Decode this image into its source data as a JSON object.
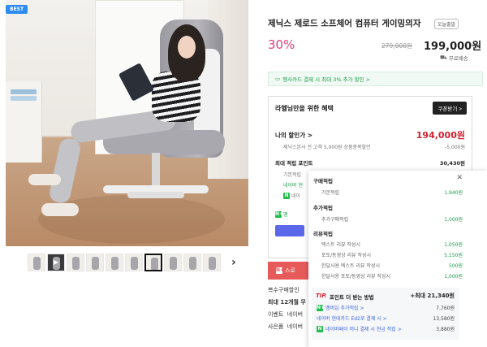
{
  "gallery": {
    "badge": "BEST",
    "thumb_count": 10,
    "selected_thumb": 7,
    "next_icon": "chevron-right-icon"
  },
  "product": {
    "title": "제닉스 제로드 소프체어 컴퓨터 게이밍의자",
    "chip": "오늘출발",
    "discount": "30%",
    "original_price": "279,000원",
    "price": "199,000원",
    "shipping": "무료배송"
  },
  "promo": {
    "text": "행사카드 결제 시 최대 3% 추가 할인 >"
  },
  "benefit": {
    "title": "라헬님만을 위한 혜택",
    "coupon_button": "쿠폰받기 >",
    "my_price_label": "나의 할인가 >",
    "my_price": "194,000원",
    "my_price_sub": "제닉스본사 전 고객 5,000원 상품중복할인",
    "my_price_sub_value": "-5,000원",
    "points_label": "최대 적립 포인트",
    "points_value": "30,430원",
    "points_rows": [
      "기본적립",
      "네이버 현",
      "네이"
    ],
    "naver_badge": "N",
    "naver_plus_label": "멤"
  },
  "popover": {
    "close_icon": "close-icon",
    "sections": [
      {
        "heading": "구매적립",
        "items": [
          {
            "label": "기본적립",
            "value": "1,940원"
          }
        ]
      },
      {
        "heading": "추가적립",
        "items": [
          {
            "label": "추가구매적립",
            "value": "1,000원"
          }
        ]
      },
      {
        "heading": "리뷰적립",
        "items": [
          {
            "label": "텍스트 리뷰 작성시",
            "value": "1,050원"
          },
          {
            "label": "포토/동영상 리뷰 작성시",
            "value": "5,150원"
          },
          {
            "label": "한달사용 텍스트 리뷰 작성시",
            "value": "500원"
          },
          {
            "label": "한달사용 포토/동영상 리뷰 작성시",
            "value": "1,000원"
          }
        ]
      }
    ],
    "tip": {
      "logo": "TIP.",
      "title": "포인트 더 받는 방법",
      "max": "+최대 21,340원",
      "rows": [
        {
          "badge": "N+",
          "label": "멤버십 추가적립 >",
          "value": "7,760원"
        },
        {
          "badge": "",
          "label": "네이버 현대카드 Ed2로 결제 시 >",
          "value": "13,580원"
        },
        {
          "badge": "N",
          "label": "네이버페이 머니 결제 시 현금 적립 >",
          "value": "3,880원"
        }
      ]
    }
  },
  "below": {
    "red_bar_badge": "N+",
    "red_bar_label": "스로",
    "rows": [
      {
        "label": "복수구매할인",
        "value": ""
      },
      {
        "label": "최대 12개월 무",
        "value": "",
        "bold": true
      },
      {
        "label": "이벤트",
        "value": "네이버"
      },
      {
        "label": "사은품",
        "value": "네이버"
      }
    ]
  }
}
